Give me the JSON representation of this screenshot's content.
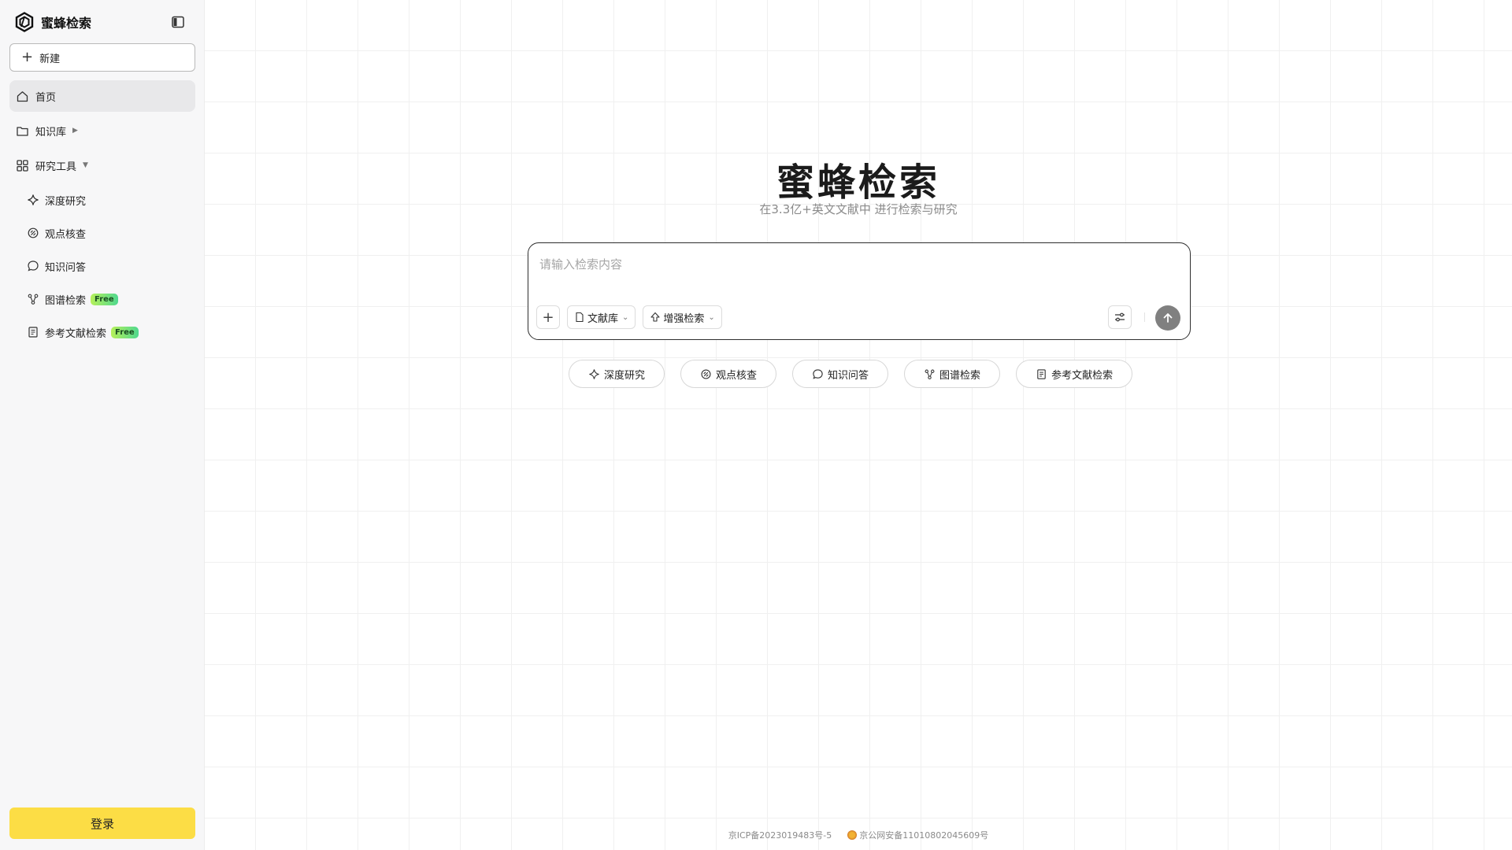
{
  "brand": {
    "name": "蜜蜂检索"
  },
  "sidebar": {
    "new_label": "新建",
    "nav": [
      {
        "label": "首页",
        "icon": "home-icon"
      },
      {
        "label": "知识库",
        "icon": "folder-icon"
      },
      {
        "label": "研究工具",
        "icon": "grid-icon"
      }
    ],
    "tools": [
      {
        "label": "深度研究",
        "icon": "sparkle-icon"
      },
      {
        "label": "观点核查",
        "icon": "link-icon"
      },
      {
        "label": "知识问答",
        "icon": "chat-icon"
      },
      {
        "label": "图谱检索",
        "icon": "graph-icon",
        "badge": "Free"
      },
      {
        "label": "参考文献检索",
        "icon": "reference-icon",
        "badge": "Free"
      }
    ],
    "login_label": "登录"
  },
  "hero": {
    "title": "蜜蜂检索",
    "subtitle": "在3.3亿+英文文献中 进行检索与研究"
  },
  "search": {
    "placeholder": "请输入检索内容",
    "library_label": "文献库",
    "enhanced_label": "增强检索"
  },
  "chips": [
    "深度研究",
    "观点核查",
    "知识问答",
    "图谱检索",
    "参考文献检索"
  ],
  "footer": {
    "icp": "京ICP备2023019483号-5",
    "police": "京公网安备11010802045609号"
  },
  "colors": {
    "login_button": "#fcdd45",
    "send_button": "#808080",
    "badge_gradient_start": "#b6f05a",
    "badge_gradient_end": "#4fd88f"
  }
}
